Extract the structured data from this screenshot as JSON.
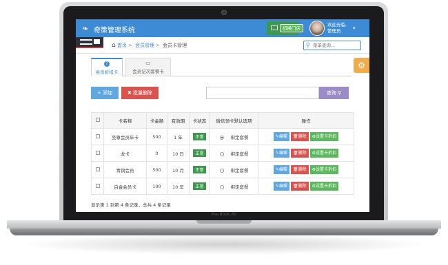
{
  "app": {
    "title": "奇策管理系统",
    "switch_store": "切换门店"
  },
  "user": {
    "welcome": "欢迎光临,",
    "role": "管理员"
  },
  "breadcrumb": {
    "home": "首页",
    "level1": "会员管理",
    "level2": "会员卡管理"
  },
  "search": {
    "placeholder": "菜单查询..."
  },
  "tabs": [
    {
      "label": "会员折扣卡",
      "icon": "?"
    },
    {
      "label": "会员记次套餐卡",
      "icon": "credit-card-icon"
    }
  ],
  "toolbar": {
    "add_label": "添加",
    "batch_delete_label": "批量删除",
    "query_label": "查询"
  },
  "table": {
    "headers": [
      "卡名称",
      "卡金额",
      "有效期",
      "卡状态",
      "微信领卡默认选项",
      "操作"
    ],
    "rows": [
      {
        "name": "至尊会员年卡",
        "amount": "500",
        "validity": "1 年",
        "status": "正常",
        "wechat_default": true,
        "bind": "绑定套餐"
      },
      {
        "name": "龙卡",
        "amount": "0",
        "validity": "10 日",
        "status": "正常",
        "wechat_default": false,
        "bind": "绑定套餐"
      },
      {
        "name": "青铜会员",
        "amount": "500",
        "validity": "10 月",
        "status": "正常",
        "wechat_default": false,
        "bind": "绑定套餐"
      },
      {
        "name": "白金会员卡",
        "amount": "100",
        "validity": "10 年",
        "status": "正常",
        "wechat_default": false,
        "bind": "绑定套餐"
      }
    ],
    "actions": {
      "edit": "编辑",
      "delete": "删除",
      "discount": "设置卡折扣"
    }
  },
  "pagination": {
    "summary": "显示第 1 到第 4 条记录，总共 4 条记录"
  },
  "device": {
    "brand": "MacBook Air"
  },
  "colors": {
    "primary": "#3d8bd4",
    "danger": "#d9534f",
    "success": "#5cb85c",
    "warning": "#f0ad4e",
    "query": "#9b8cc8"
  }
}
